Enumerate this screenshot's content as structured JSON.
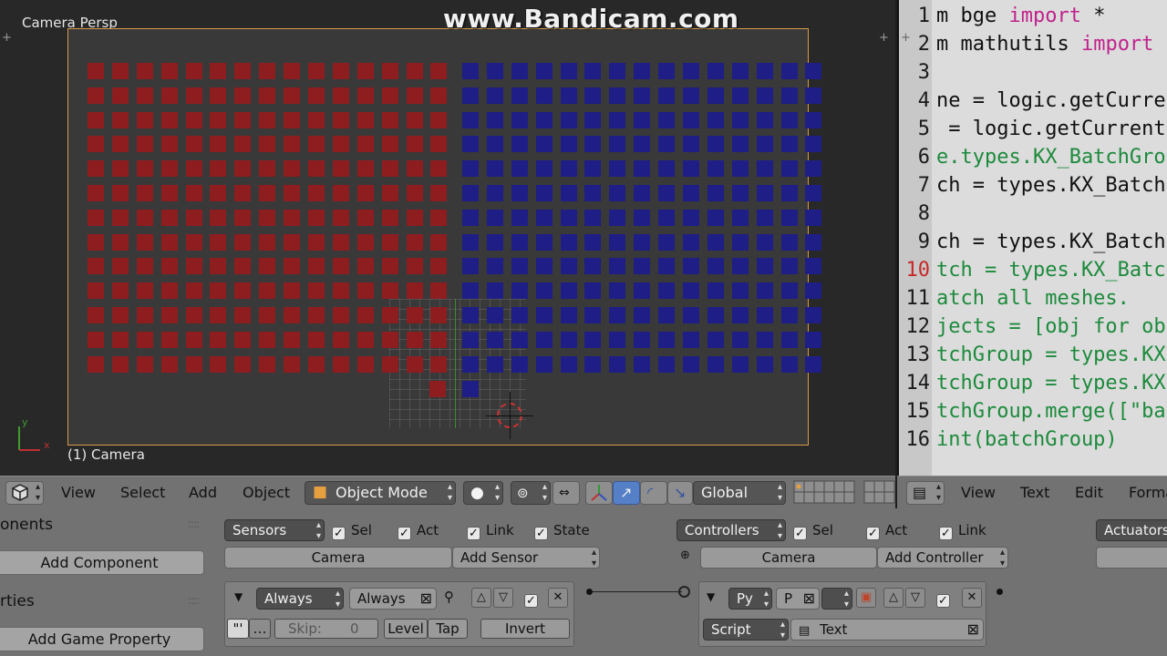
{
  "watermark": "www.Bandicam.com",
  "viewport": {
    "label": "Camera Persp",
    "object_label": "(1) Camera",
    "axis_y": "y",
    "axis_x": "x",
    "red_rows": 13,
    "red_cols": 15,
    "blue_rows": 13,
    "blue_cols": 15,
    "colors": {
      "red": "#8e1d20",
      "blue": "#1e1e86",
      "frame": "#d79c4a"
    }
  },
  "text_editor": {
    "lines": [
      {
        "num": "1",
        "text": "m bge ",
        "kw": "import",
        "rest": " *",
        "style": "normal"
      },
      {
        "num": "2",
        "text": "m mathutils ",
        "kw": "import",
        "rest": "",
        "style": "normal"
      },
      {
        "num": "3",
        "text": "",
        "kw": "",
        "rest": "",
        "style": "normal"
      },
      {
        "num": "4",
        "text": "ne = logic.getCurre",
        "kw": "",
        "rest": "",
        "style": "normal"
      },
      {
        "num": "5",
        "text": " = logic.getCurrent",
        "kw": "",
        "rest": "",
        "style": "normal"
      },
      {
        "num": "6",
        "text": "e.types.KX_BatchGro",
        "kw": "",
        "rest": "",
        "style": "comment"
      },
      {
        "num": "7",
        "text": "ch = types.KX_Batch",
        "kw": "",
        "rest": "",
        "style": "normal"
      },
      {
        "num": "8",
        "text": "",
        "kw": "",
        "rest": "",
        "style": "normal"
      },
      {
        "num": "9",
        "text": "ch = types.KX_Batch",
        "kw": "",
        "rest": "",
        "style": "normal"
      },
      {
        "num": "10",
        "text": "tch = types.KX_Batc",
        "kw": "",
        "rest": "",
        "style": "comment"
      },
      {
        "num": "11",
        "text": "atch all meshes.",
        "kw": "",
        "rest": "",
        "style": "comment"
      },
      {
        "num": "12",
        "text": "jects = [obj for ob",
        "kw": "",
        "rest": "",
        "style": "comment"
      },
      {
        "num": "13",
        "text": "tchGroup = types.KX",
        "kw": "",
        "rest": "",
        "style": "comment"
      },
      {
        "num": "14",
        "text": "tchGroup = types.KX",
        "kw": "",
        "rest": "",
        "style": "comment"
      },
      {
        "num": "15",
        "text": "tchGroup.merge([\"ba",
        "kw": "",
        "rest": "",
        "style": "comment"
      },
      {
        "num": "16",
        "text": "int(batchGroup)",
        "kw": "",
        "rest": "",
        "style": "comment"
      }
    ],
    "current_line": "10"
  },
  "vp_toolbar": {
    "view": "View",
    "select": "Select",
    "add": "Add",
    "object": "Object",
    "mode": "Object Mode",
    "orientation": "Global"
  },
  "te_toolbar": {
    "view": "View",
    "text": "Text",
    "edit": "Edit",
    "format": "Forma"
  },
  "logic": {
    "components_header": "onents",
    "add_component": "Add Component",
    "properties_header": "rties",
    "add_game_property": "Add Game Property",
    "sensors": {
      "dropdown": "Sensors",
      "sel": "Sel",
      "act": "Act",
      "link": "Link",
      "state": "State",
      "object": "Camera",
      "add": "Add Sensor",
      "brick_type": "Always",
      "brick_name": "Always",
      "skip_label": "Skip:",
      "skip_value": "0",
      "level": "Level",
      "tap": "Tap",
      "invert": "Invert"
    },
    "controllers": {
      "dropdown": "Controllers",
      "sel": "Sel",
      "act": "Act",
      "link": "Link",
      "object": "Camera",
      "add": "Add Controller",
      "brick_type": "Py",
      "brick_name": "P",
      "script_mode": "Script",
      "script_name": "Text"
    },
    "actuators": {
      "dropdown": "Actuators"
    }
  }
}
